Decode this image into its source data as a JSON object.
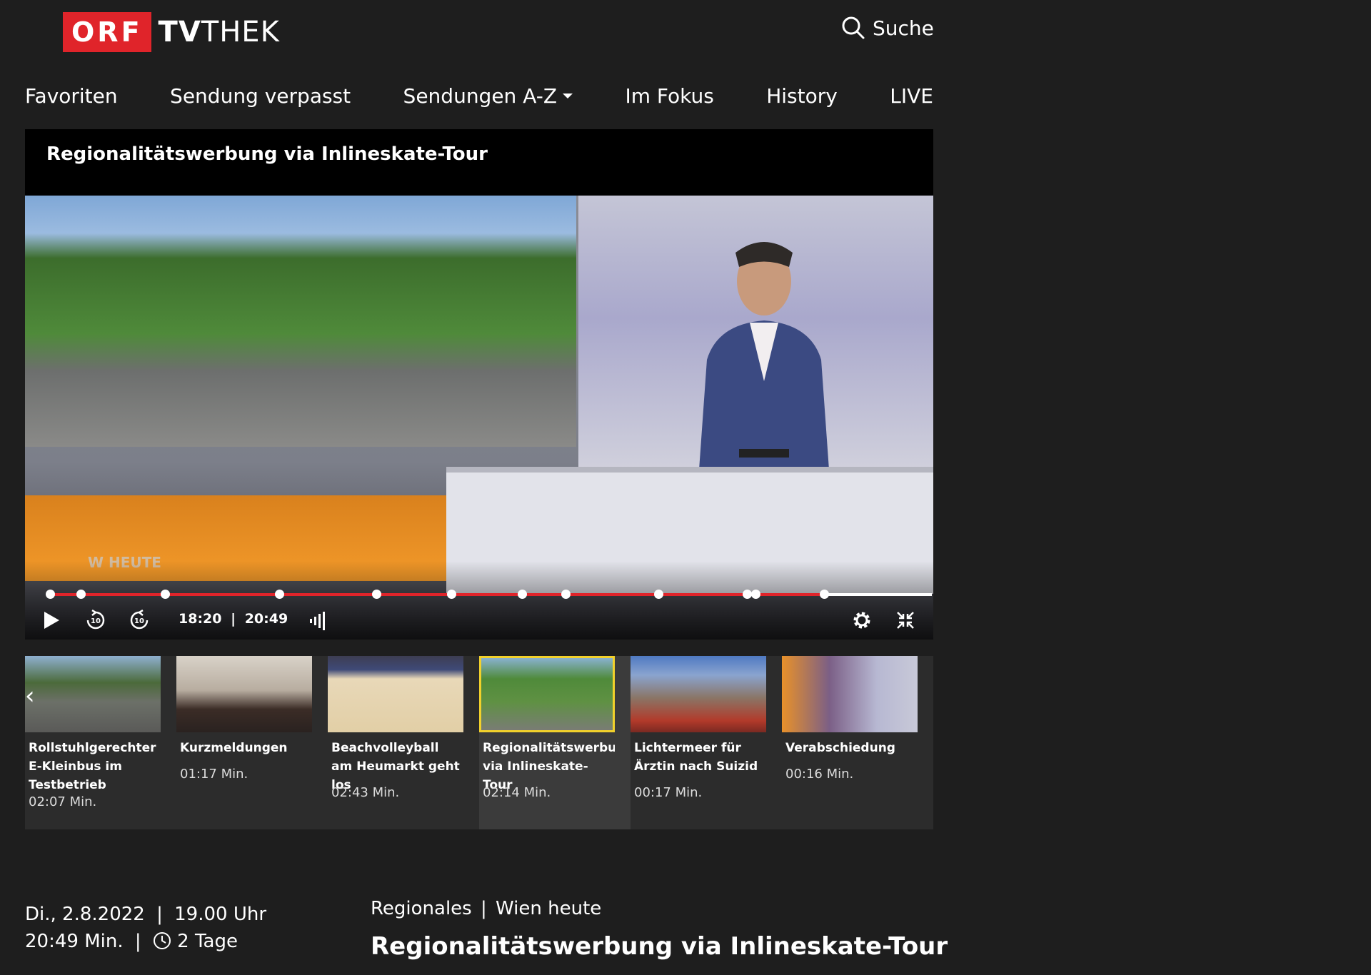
{
  "header": {
    "logo_orf": "ORF",
    "logo_tv": "TV",
    "logo_thek": "THEK",
    "search_label": "Suche"
  },
  "nav": {
    "items": [
      "Favoriten",
      "Sendung verpasst",
      "Sendungen A-Z",
      "Im Fokus",
      "History",
      "LIVE"
    ]
  },
  "player": {
    "title": "Regionalitätswerbung via Inlineskate-Tour",
    "overlay_badge": "W HEUTE",
    "time_current": "18:20",
    "time_separator": "|",
    "time_total": "20:49",
    "progress": 0.878,
    "chapter_markers": [
      0.0,
      0.035,
      0.13,
      0.26,
      0.37,
      0.455,
      0.535,
      0.585,
      0.69,
      0.79,
      0.8
    ]
  },
  "segments": [
    {
      "title": "Rollstuhlgerechter E-Kleinbus im Testbetrieb",
      "duration": "02:07 Min.",
      "active": false
    },
    {
      "title": "Kurzmeldungen",
      "duration": "01:17 Min.",
      "active": false
    },
    {
      "title": "Beachvolleyball am Heumarkt geht los",
      "duration": "02:43 Min.",
      "active": false
    },
    {
      "title": "Regionalitätswerbung via Inlineskate-Tour",
      "duration": "02:14 Min.",
      "active": true
    },
    {
      "title": "Lichtermeer für Ärztin nach Suizid",
      "duration": "00:17 Min.",
      "active": false
    },
    {
      "title": "Verabschiedung",
      "duration": "00:16 Min.",
      "active": false
    }
  ],
  "meta": {
    "date": "Di., 2.8.2022",
    "time": "19.00 Uhr",
    "length": "20:49 Min.",
    "availability": "2 Tage",
    "separator": "|",
    "category": "Regionales",
    "show": "Wien heute",
    "episode_title": "Regionalitätswerbung via Inlineskate-Tour"
  },
  "colors": {
    "background": "#1e1e1e",
    "brand_red": "#e0242a",
    "active_outline": "#f2d12b"
  }
}
